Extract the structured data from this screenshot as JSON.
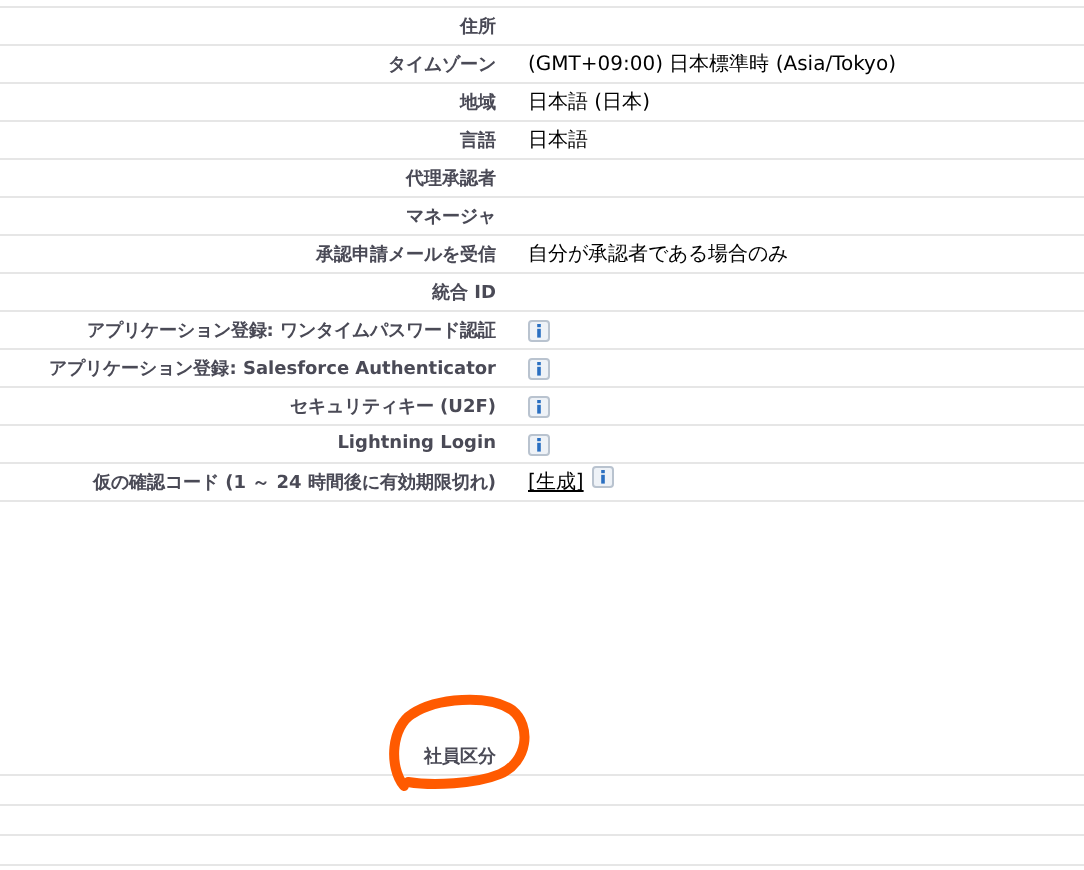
{
  "rows": [
    {
      "kind": "text",
      "label": "住所"
    },
    {
      "kind": "text",
      "label": "タイムゾーン",
      "value": "(GMT+09:00) 日本標準時 (Asia/Tokyo)"
    },
    {
      "kind": "text",
      "label": "地域",
      "value": "日本語 (日本)"
    },
    {
      "kind": "text",
      "label": "言語",
      "value": "日本語"
    },
    {
      "kind": "text",
      "label": "代理承認者"
    },
    {
      "kind": "text",
      "label": "マネージャ"
    },
    {
      "kind": "text",
      "label": "承認申請メールを受信",
      "value": "自分が承認者である場合のみ"
    },
    {
      "kind": "text",
      "label": "統合 ID"
    },
    {
      "kind": "info",
      "label": "アプリケーション登録: ワンタイムパスワード認証"
    },
    {
      "kind": "info",
      "label": "アプリケーション登録: Salesforce Authenticator"
    },
    {
      "kind": "info",
      "label": "セキュリティキー (U2F)"
    },
    {
      "kind": "info",
      "label": "Lightning Login"
    },
    {
      "kind": "link_info",
      "label": "仮の確認コード (1 ～ 24 時間後に有効期限切れ)",
      "link": "[生成]"
    }
  ],
  "section": {
    "label": "社員区分",
    "highlighted": true
  }
}
